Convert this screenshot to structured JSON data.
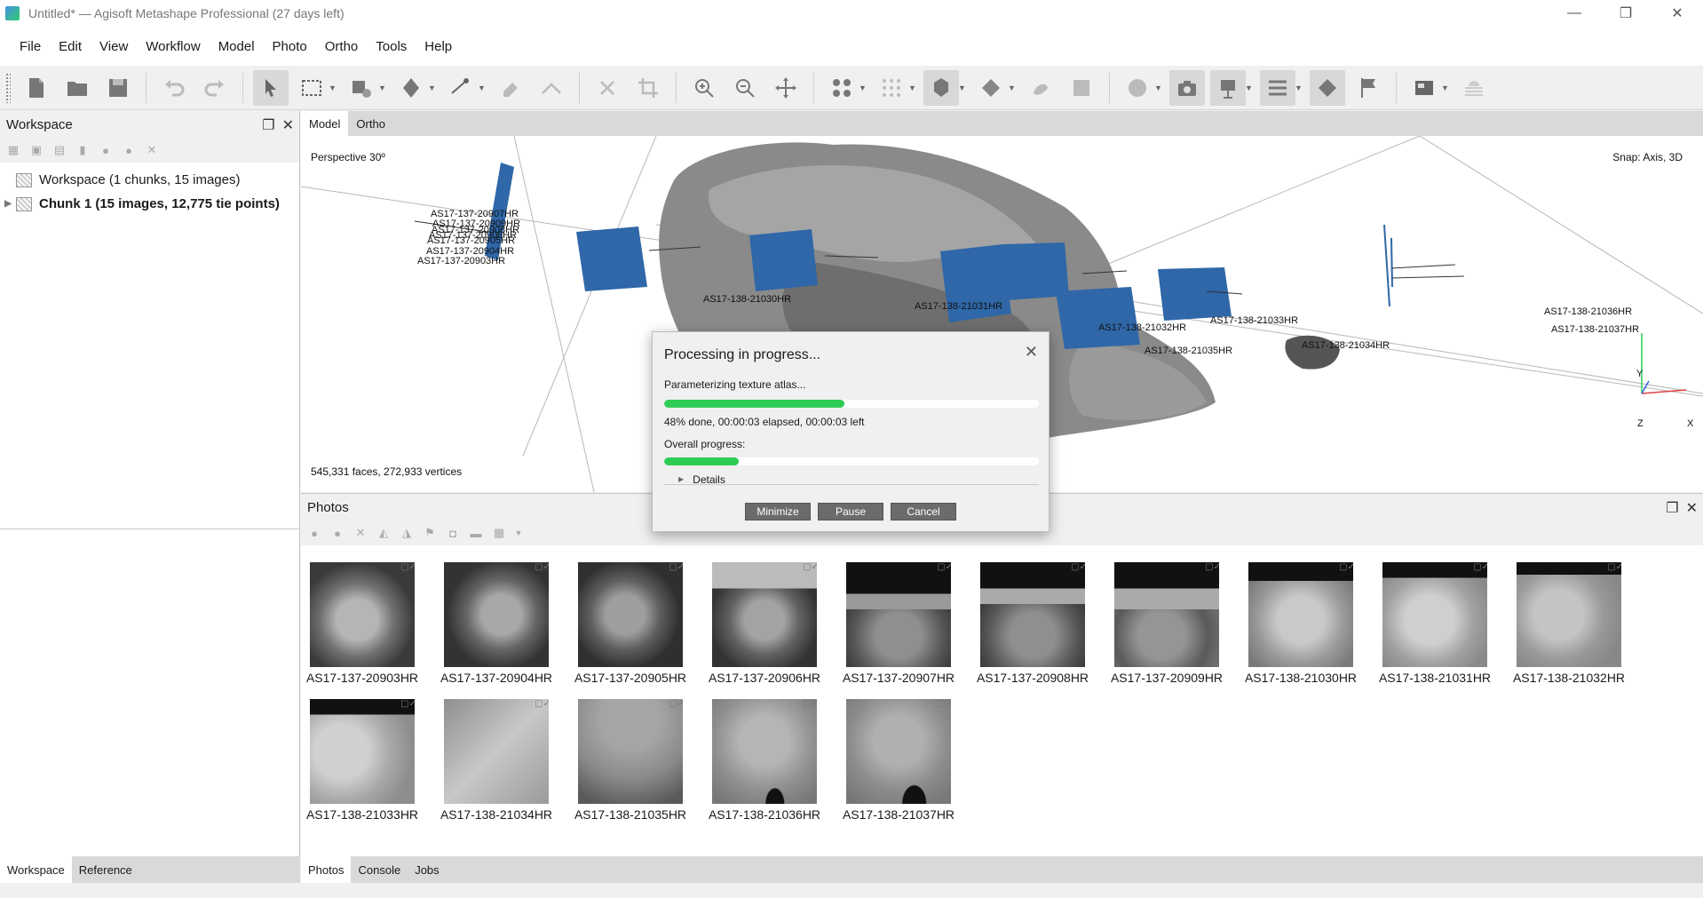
{
  "window": {
    "title": "Untitled* — Agisoft Metashape Professional (27 days left)",
    "minimize": "—",
    "maximize": "❐",
    "close": "✕"
  },
  "menu": [
    "File",
    "Edit",
    "View",
    "Workflow",
    "Model",
    "Photo",
    "Ortho",
    "Tools",
    "Help"
  ],
  "workspace": {
    "title": "Workspace",
    "root_label": "Workspace (1 chunks, 15 images)",
    "chunk_label": "Chunk 1 (15 images, 12,775 tie points)"
  },
  "left_tabs": [
    "Workspace",
    "Reference"
  ],
  "view_tabs": [
    "Model",
    "Ortho"
  ],
  "model_view": {
    "perspective": "Perspective 30º",
    "snap": "Snap: Axis, 3D",
    "stats": "545,331 faces, 272,933 vertices",
    "axis_x": "X",
    "axis_y": "Y",
    "axis_z": "Z",
    "camera_labels": [
      "AS17-137-20907HR",
      "AS17-137-20909HR",
      "AS17-137-20908HR",
      "AS17-137-20906HR",
      "AS17-137-20905HR",
      "AS17-137-20904HR",
      "AS17-137-20903HR",
      "AS17-138-21030HR",
      "AS17-138-21031HR",
      "AS17-138-21032HR",
      "AS17-138-21033HR",
      "AS17-138-21035HR",
      "AS17-138-21034HR",
      "AS17-138-21036HR",
      "AS17-138-21037HR"
    ]
  },
  "photos": {
    "title": "Photos",
    "items": [
      "AS17-137-20903HR",
      "AS17-137-20904HR",
      "AS17-137-20905HR",
      "AS17-137-20906HR",
      "AS17-137-20907HR",
      "AS17-137-20908HR",
      "AS17-137-20909HR",
      "AS17-138-21030HR",
      "AS17-138-21031HR",
      "AS17-138-21032HR",
      "AS17-138-21033HR",
      "AS17-138-21034HR",
      "AS17-138-21035HR",
      "AS17-138-21036HR",
      "AS17-138-21037HR"
    ]
  },
  "bottom_tabs": [
    "Photos",
    "Console",
    "Jobs"
  ],
  "dialog": {
    "title": "Processing in progress...",
    "stage": "Parameterizing texture atlas...",
    "stage_progress": 0.48,
    "status": "48% done, 00:00:03 elapsed, 00:00:03 left",
    "overall_label": "Overall progress:",
    "overall_progress": 0.2,
    "details_label": "Details",
    "minimize_label": "Minimize",
    "pause_label": "Pause",
    "cancel_label": "Cancel"
  },
  "colors": {
    "progress": "#2ecc55",
    "camera_plane": "#2f67a8"
  }
}
